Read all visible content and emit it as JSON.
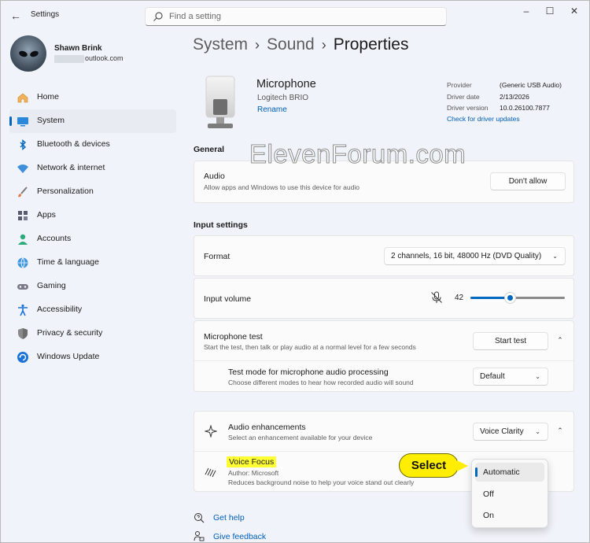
{
  "titlebar": {
    "app_title": "Settings",
    "search_placeholder": "Find a setting"
  },
  "user": {
    "name": "Shawn Brink",
    "email_suffix": "outlook.com"
  },
  "nav": [
    {
      "label": "Home",
      "icon": "home-icon"
    },
    {
      "label": "System",
      "icon": "system-icon",
      "active": true
    },
    {
      "label": "Bluetooth & devices",
      "icon": "bluetooth-icon"
    },
    {
      "label": "Network & internet",
      "icon": "wifi-icon"
    },
    {
      "label": "Personalization",
      "icon": "brush-icon"
    },
    {
      "label": "Apps",
      "icon": "apps-icon"
    },
    {
      "label": "Accounts",
      "icon": "accounts-icon"
    },
    {
      "label": "Time & language",
      "icon": "globe-icon"
    },
    {
      "label": "Gaming",
      "icon": "gamepad-icon"
    },
    {
      "label": "Accessibility",
      "icon": "accessibility-icon"
    },
    {
      "label": "Privacy & security",
      "icon": "shield-icon"
    },
    {
      "label": "Windows Update",
      "icon": "update-icon"
    }
  ],
  "breadcrumb": {
    "part1": "System",
    "part2": "Sound",
    "current": "Properties"
  },
  "device": {
    "name": "Microphone",
    "model": "Logitech BRIO",
    "rename": "Rename",
    "provider_label": "Provider",
    "provider": "(Generic USB Audio)",
    "date_label": "Driver date",
    "date": "2/13/2026",
    "version_label": "Driver version",
    "version": "10.0.26100.7877",
    "driver_link": "Check for driver updates"
  },
  "general": {
    "heading": "General",
    "audio_title": "Audio",
    "audio_sub": "Allow apps and Windows to use this device for audio",
    "dont_allow": "Don't allow"
  },
  "input": {
    "heading": "Input settings",
    "format_label": "Format",
    "format_value": "2 channels, 16 bit, 48000 Hz (DVD Quality)",
    "volume_label": "Input volume",
    "volume_value": "42",
    "volume_level": 0.42,
    "mic_test_title": "Microphone test",
    "mic_test_sub": "Start the test, then talk or play audio at a normal level for a few seconds",
    "start_test": "Start test",
    "test_mode_title": "Test mode for microphone audio processing",
    "test_mode_sub": "Choose different modes to hear how recorded audio will sound",
    "test_mode_value": "Default"
  },
  "enhancements": {
    "title": "Audio enhancements",
    "sub": "Select an enhancement available for your device",
    "value": "Voice Clarity",
    "vf_title": "Voice Focus",
    "vf_author": "Author: Microsoft",
    "vf_desc": "Reduces background noise to help your voice stand out clearly",
    "options": [
      "Automatic",
      "Off",
      "On"
    ],
    "selected_option": "Automatic"
  },
  "callout": "Select",
  "footer": {
    "help": "Get help",
    "feedback": "Give feedback"
  },
  "watermark": "ElevenForum.com",
  "colors": {
    "accent": "#0067c0",
    "link": "#005fb8",
    "highlight": "#ffff33",
    "callout": "#ffee00"
  }
}
